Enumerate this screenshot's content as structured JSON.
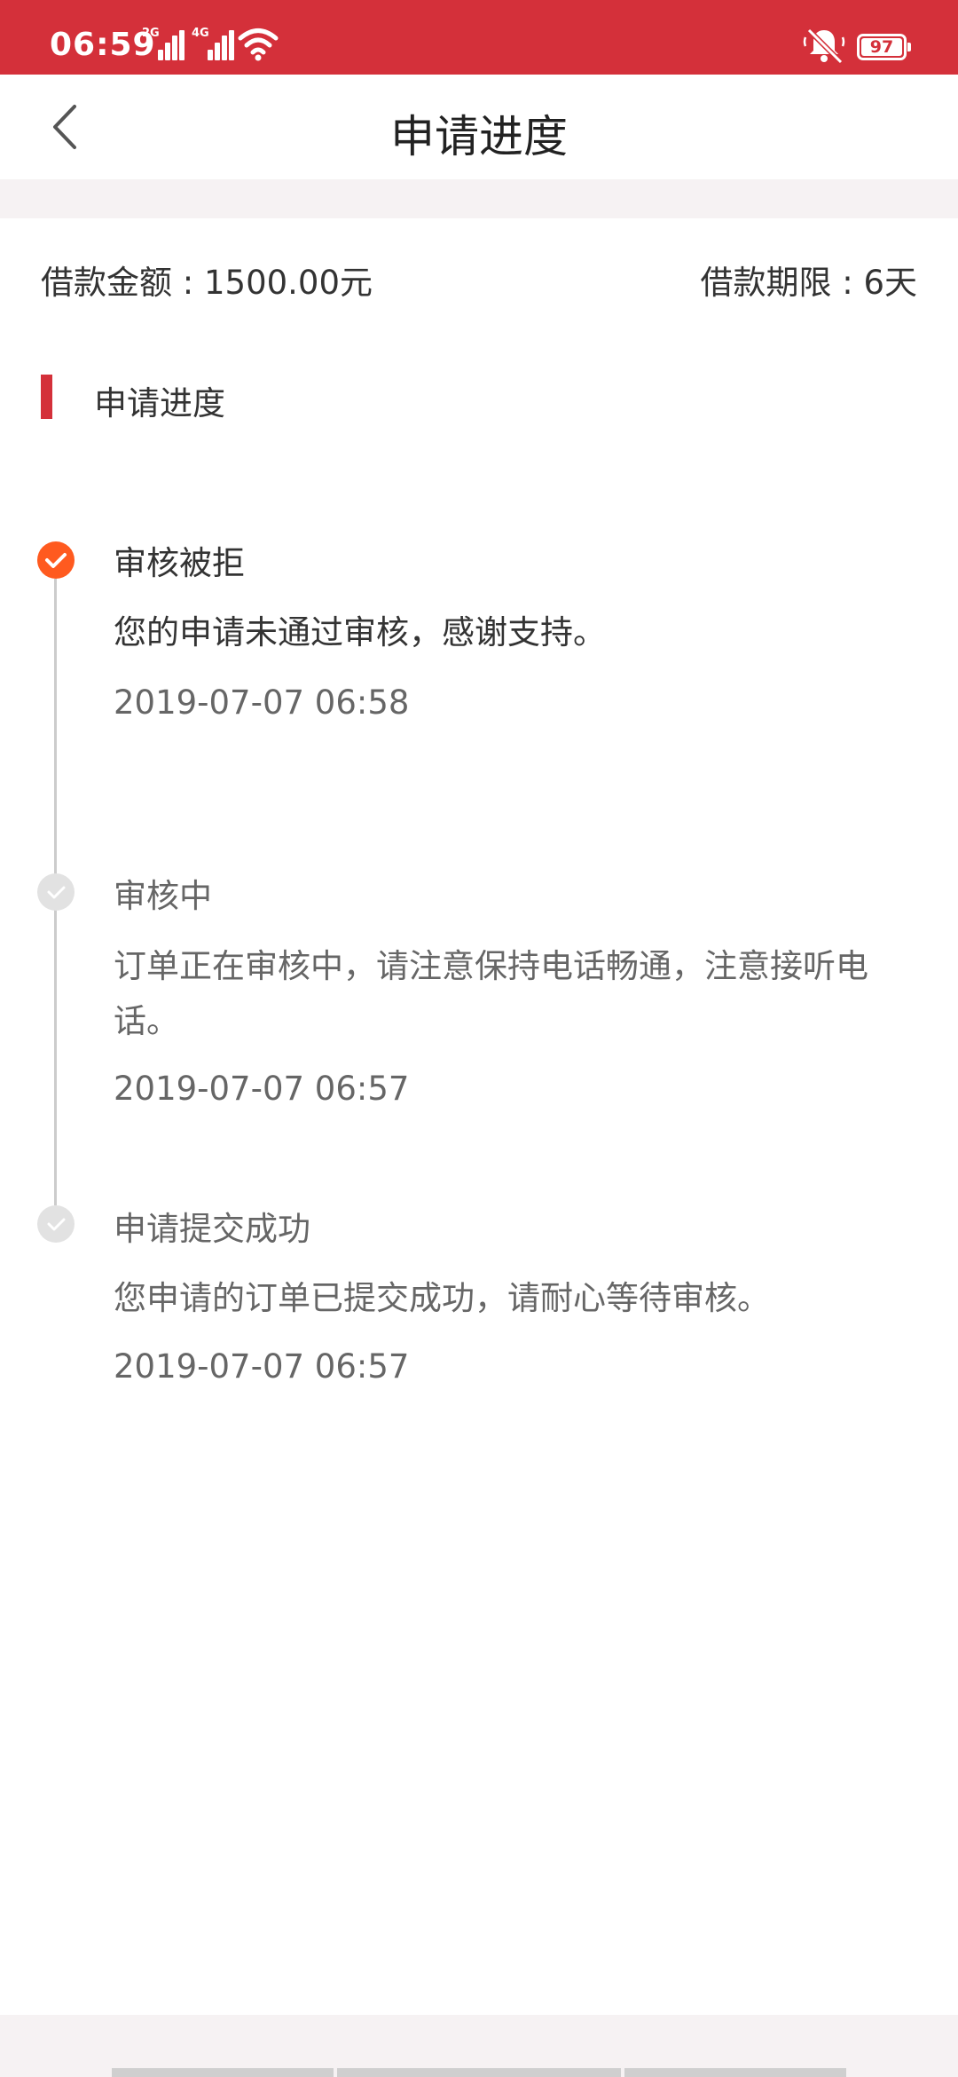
{
  "status_bar": {
    "time": "06:59",
    "network_1": "2G",
    "network_2": "4G",
    "battery": "97",
    "icons": [
      "signal-icon",
      "wifi-icon",
      "mute-icon",
      "battery-icon"
    ]
  },
  "nav": {
    "back_icon": "chevron-left-icon",
    "title": "申请进度"
  },
  "loan": {
    "amount": "借款金额 : 1500.00元",
    "term": "借款期限 : 6天"
  },
  "section": {
    "title": "申请进度"
  },
  "timeline": [
    {
      "title": "审核被拒",
      "desc": "您的申请未通过审核，感谢支持。",
      "time": "2019-07-07 06:58",
      "active": true
    },
    {
      "title": "审核中",
      "desc": "订单正在审核中，请注意保持电话畅通，注意接听电话。",
      "time": "2019-07-07 06:57",
      "active": false
    },
    {
      "title": "申请提交成功",
      "desc": "您申请的订单已提交成功，请耐心等待审核。",
      "time": "2019-07-07 06:57",
      "active": false
    }
  ],
  "colors": {
    "brand_red": "#d4303a",
    "active_orange": "#ff5a1f",
    "inactive_gray": "#e2e2e2"
  }
}
